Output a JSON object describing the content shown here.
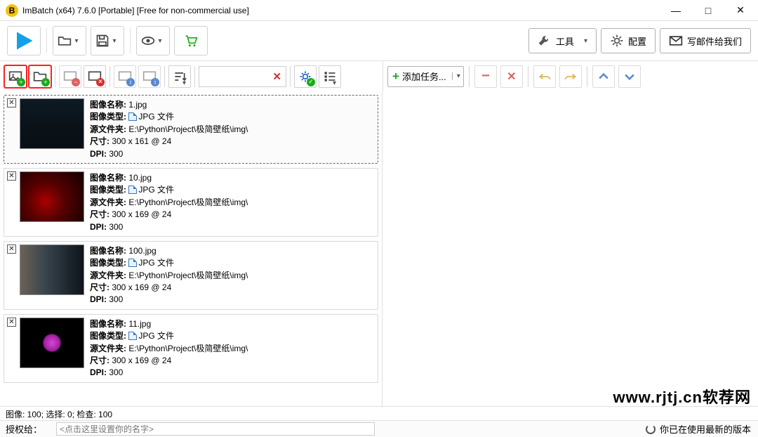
{
  "window": {
    "title": "ImBatch (x64) 7.6.0 [Portable] [Free for non-commercial use]",
    "app_letter": "B"
  },
  "topbar": {
    "tools_label": "工具",
    "config_label": "配置",
    "mail_label": "写邮件给我们"
  },
  "toolbar2": {
    "add_task_label": "添加任务..."
  },
  "labels": {
    "name": "图像名称:",
    "type": "图像类型:",
    "folder": "源文件夹:",
    "size": "尺寸:",
    "dpi": "DPI:"
  },
  "items": [
    {
      "name": "1.jpg",
      "type": "JPG 文件",
      "folder": "E:\\Python\\Project\\极简壁纸\\img\\",
      "size": "300 x 161 @ 24",
      "dpi": "300",
      "thumb": "dark-struct",
      "selected": true
    },
    {
      "name": "10.jpg",
      "type": "JPG 文件",
      "folder": "E:\\Python\\Project\\极简壁纸\\img\\",
      "size": "300 x 169 @ 24",
      "dpi": "300",
      "thumb": "red-cubes",
      "selected": false
    },
    {
      "name": "100.jpg",
      "type": "JPG 文件",
      "folder": "E:\\Python\\Project\\极简壁纸\\img\\",
      "size": "300 x 169 @ 24",
      "dpi": "300",
      "thumb": "car",
      "selected": false
    },
    {
      "name": "11.jpg",
      "type": "JPG 文件",
      "folder": "E:\\Python\\Project\\极简壁纸\\img\\",
      "size": "300 x 169 @ 24",
      "dpi": "300",
      "thumb": "purple",
      "selected": false
    }
  ],
  "status1": "图像: 100; 选择: 0; 检查: 100",
  "status2": {
    "label": "授权给：",
    "placeholder": "<点击这里设置你的名字>",
    "update": "你已在使用最新的版本"
  },
  "watermark": "www.rjtj.cn软荐网"
}
